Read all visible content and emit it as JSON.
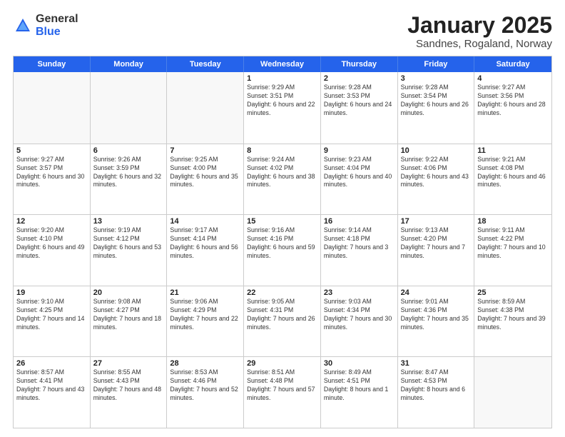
{
  "logo": {
    "general": "General",
    "blue": "Blue"
  },
  "title": {
    "month": "January 2025",
    "location": "Sandnes, Rogaland, Norway"
  },
  "header_days": [
    "Sunday",
    "Monday",
    "Tuesday",
    "Wednesday",
    "Thursday",
    "Friday",
    "Saturday"
  ],
  "weeks": [
    [
      {
        "day": "",
        "sunrise": "",
        "sunset": "",
        "daylight": ""
      },
      {
        "day": "",
        "sunrise": "",
        "sunset": "",
        "daylight": ""
      },
      {
        "day": "",
        "sunrise": "",
        "sunset": "",
        "daylight": ""
      },
      {
        "day": "1",
        "sunrise": "Sunrise: 9:29 AM",
        "sunset": "Sunset: 3:51 PM",
        "daylight": "Daylight: 6 hours and 22 minutes."
      },
      {
        "day": "2",
        "sunrise": "Sunrise: 9:28 AM",
        "sunset": "Sunset: 3:53 PM",
        "daylight": "Daylight: 6 hours and 24 minutes."
      },
      {
        "day": "3",
        "sunrise": "Sunrise: 9:28 AM",
        "sunset": "Sunset: 3:54 PM",
        "daylight": "Daylight: 6 hours and 26 minutes."
      },
      {
        "day": "4",
        "sunrise": "Sunrise: 9:27 AM",
        "sunset": "Sunset: 3:56 PM",
        "daylight": "Daylight: 6 hours and 28 minutes."
      }
    ],
    [
      {
        "day": "5",
        "sunrise": "Sunrise: 9:27 AM",
        "sunset": "Sunset: 3:57 PM",
        "daylight": "Daylight: 6 hours and 30 minutes."
      },
      {
        "day": "6",
        "sunrise": "Sunrise: 9:26 AM",
        "sunset": "Sunset: 3:59 PM",
        "daylight": "Daylight: 6 hours and 32 minutes."
      },
      {
        "day": "7",
        "sunrise": "Sunrise: 9:25 AM",
        "sunset": "Sunset: 4:00 PM",
        "daylight": "Daylight: 6 hours and 35 minutes."
      },
      {
        "day": "8",
        "sunrise": "Sunrise: 9:24 AM",
        "sunset": "Sunset: 4:02 PM",
        "daylight": "Daylight: 6 hours and 38 minutes."
      },
      {
        "day": "9",
        "sunrise": "Sunrise: 9:23 AM",
        "sunset": "Sunset: 4:04 PM",
        "daylight": "Daylight: 6 hours and 40 minutes."
      },
      {
        "day": "10",
        "sunrise": "Sunrise: 9:22 AM",
        "sunset": "Sunset: 4:06 PM",
        "daylight": "Daylight: 6 hours and 43 minutes."
      },
      {
        "day": "11",
        "sunrise": "Sunrise: 9:21 AM",
        "sunset": "Sunset: 4:08 PM",
        "daylight": "Daylight: 6 hours and 46 minutes."
      }
    ],
    [
      {
        "day": "12",
        "sunrise": "Sunrise: 9:20 AM",
        "sunset": "Sunset: 4:10 PM",
        "daylight": "Daylight: 6 hours and 49 minutes."
      },
      {
        "day": "13",
        "sunrise": "Sunrise: 9:19 AM",
        "sunset": "Sunset: 4:12 PM",
        "daylight": "Daylight: 6 hours and 53 minutes."
      },
      {
        "day": "14",
        "sunrise": "Sunrise: 9:17 AM",
        "sunset": "Sunset: 4:14 PM",
        "daylight": "Daylight: 6 hours and 56 minutes."
      },
      {
        "day": "15",
        "sunrise": "Sunrise: 9:16 AM",
        "sunset": "Sunset: 4:16 PM",
        "daylight": "Daylight: 6 hours and 59 minutes."
      },
      {
        "day": "16",
        "sunrise": "Sunrise: 9:14 AM",
        "sunset": "Sunset: 4:18 PM",
        "daylight": "Daylight: 7 hours and 3 minutes."
      },
      {
        "day": "17",
        "sunrise": "Sunrise: 9:13 AM",
        "sunset": "Sunset: 4:20 PM",
        "daylight": "Daylight: 7 hours and 7 minutes."
      },
      {
        "day": "18",
        "sunrise": "Sunrise: 9:11 AM",
        "sunset": "Sunset: 4:22 PM",
        "daylight": "Daylight: 7 hours and 10 minutes."
      }
    ],
    [
      {
        "day": "19",
        "sunrise": "Sunrise: 9:10 AM",
        "sunset": "Sunset: 4:25 PM",
        "daylight": "Daylight: 7 hours and 14 minutes."
      },
      {
        "day": "20",
        "sunrise": "Sunrise: 9:08 AM",
        "sunset": "Sunset: 4:27 PM",
        "daylight": "Daylight: 7 hours and 18 minutes."
      },
      {
        "day": "21",
        "sunrise": "Sunrise: 9:06 AM",
        "sunset": "Sunset: 4:29 PM",
        "daylight": "Daylight: 7 hours and 22 minutes."
      },
      {
        "day": "22",
        "sunrise": "Sunrise: 9:05 AM",
        "sunset": "Sunset: 4:31 PM",
        "daylight": "Daylight: 7 hours and 26 minutes."
      },
      {
        "day": "23",
        "sunrise": "Sunrise: 9:03 AM",
        "sunset": "Sunset: 4:34 PM",
        "daylight": "Daylight: 7 hours and 30 minutes."
      },
      {
        "day": "24",
        "sunrise": "Sunrise: 9:01 AM",
        "sunset": "Sunset: 4:36 PM",
        "daylight": "Daylight: 7 hours and 35 minutes."
      },
      {
        "day": "25",
        "sunrise": "Sunrise: 8:59 AM",
        "sunset": "Sunset: 4:38 PM",
        "daylight": "Daylight: 7 hours and 39 minutes."
      }
    ],
    [
      {
        "day": "26",
        "sunrise": "Sunrise: 8:57 AM",
        "sunset": "Sunset: 4:41 PM",
        "daylight": "Daylight: 7 hours and 43 minutes."
      },
      {
        "day": "27",
        "sunrise": "Sunrise: 8:55 AM",
        "sunset": "Sunset: 4:43 PM",
        "daylight": "Daylight: 7 hours and 48 minutes."
      },
      {
        "day": "28",
        "sunrise": "Sunrise: 8:53 AM",
        "sunset": "Sunset: 4:46 PM",
        "daylight": "Daylight: 7 hours and 52 minutes."
      },
      {
        "day": "29",
        "sunrise": "Sunrise: 8:51 AM",
        "sunset": "Sunset: 4:48 PM",
        "daylight": "Daylight: 7 hours and 57 minutes."
      },
      {
        "day": "30",
        "sunrise": "Sunrise: 8:49 AM",
        "sunset": "Sunset: 4:51 PM",
        "daylight": "Daylight: 8 hours and 1 minute."
      },
      {
        "day": "31",
        "sunrise": "Sunrise: 8:47 AM",
        "sunset": "Sunset: 4:53 PM",
        "daylight": "Daylight: 8 hours and 6 minutes."
      },
      {
        "day": "",
        "sunrise": "",
        "sunset": "",
        "daylight": ""
      }
    ]
  ]
}
